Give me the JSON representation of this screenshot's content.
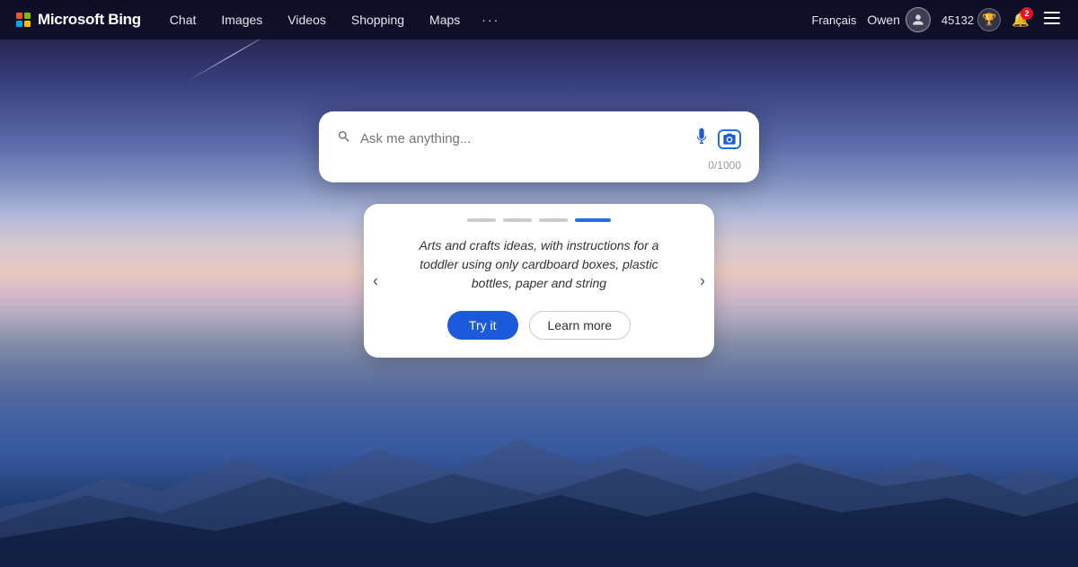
{
  "navbar": {
    "logo_text": "Microsoft Bing",
    "nav_items": [
      {
        "label": "Chat",
        "id": "chat"
      },
      {
        "label": "Images",
        "id": "images"
      },
      {
        "label": "Videos",
        "id": "videos"
      },
      {
        "label": "Shopping",
        "id": "shopping"
      },
      {
        "label": "Maps",
        "id": "maps"
      }
    ],
    "more_label": "···",
    "lang_label": "Français",
    "user_name": "Owen",
    "score": "45132",
    "notif_count": "2"
  },
  "search": {
    "placeholder": "Ask me anything...",
    "char_count": "0/1000"
  },
  "suggestion": {
    "text": "Arts and crafts ideas, with instructions for a toddler using only cardboard boxes, plastic bottles, paper and string",
    "try_label": "Try it",
    "learn_label": "Learn more",
    "dots": [
      {
        "active": false,
        "id": 0
      },
      {
        "active": false,
        "id": 1
      },
      {
        "active": false,
        "id": 2
      },
      {
        "active": true,
        "id": 3
      }
    ]
  }
}
